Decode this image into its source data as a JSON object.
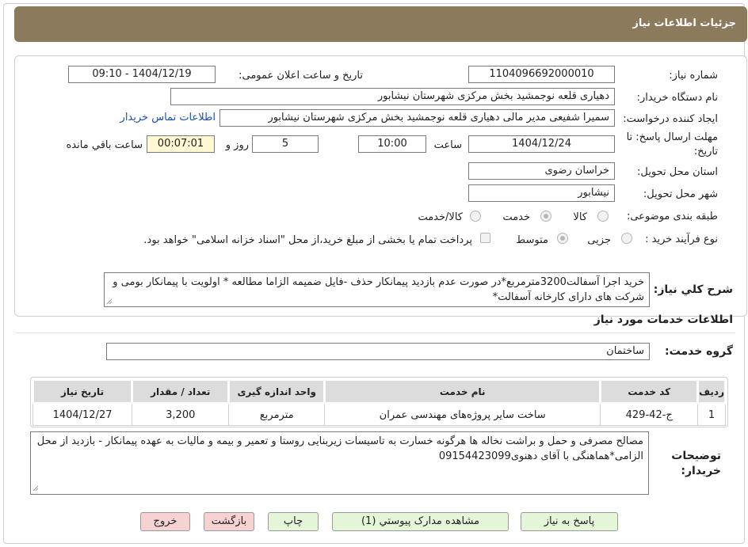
{
  "header": {
    "title": "جزئیات اطلاعات نیاز"
  },
  "form": {
    "need_number_label": "شماره نیاز:",
    "need_number": "1104096692000010",
    "announce_label": "تاریخ و ساعت اعلان عمومی:",
    "announce_value": "1404/12/19 - 09:10",
    "buyer_org_label": "نام دستگاه خریدار:",
    "buyer_org": "دهیاری قلعه نوجمشید بخش مرکزی شهرستان نیشابور",
    "requester_label": "ایجاد کننده درخواست:",
    "requester": "سمیرا شفیعی مدیر مالی دهیاری قلعه نوجمشید بخش مرکزی شهرستان نیشابور",
    "contact_link": "اطلاعات تماس خریدار",
    "deadline_label_1": "مهلت ارسال پاسخ: تا",
    "deadline_label_2": "تاریخ:",
    "deadline_date": "1404/12/24",
    "time_label": "ساعت",
    "deadline_time": "10:00",
    "days_value": "5",
    "days_label": "روز و",
    "remaining_value": "00:07:01",
    "remaining_label": "ساعت باقي مانده",
    "province_label": "استان محل تحویل:",
    "province": "خراسان رضوی",
    "city_label": "شهر محل تحویل:",
    "city": "نیشابور",
    "category_label": "طبقه بندی موضوعی:",
    "category_options": [
      "کالا",
      "خدمت",
      "کالا/خدمت"
    ],
    "category_selected": "خدمت",
    "process_label": "نوع فرآیند خرید :",
    "process_options": [
      "جزیی",
      "متوسط"
    ],
    "process_selected": "متوسط",
    "payment_note": "پرداخت تمام یا بخشی از مبلغ خرید،از محل \"اسناد خزانه اسلامی\" خواهد بود."
  },
  "description": {
    "label": "شرح کلي نیاز:",
    "text": "خرید اجرا آسفالت3200مترمربع*در صورت عدم بازدید پیمانکار حذف -فایل ضمیمه الزاما مطالعه * اولویت با پیمانکار بومی و شرکت های دارای کارخانه آسفالت*"
  },
  "services": {
    "section_title": "اطلاعات خدمات مورد نیاز",
    "group_label": "گروه خدمت:",
    "group_value": "ساختمان",
    "columns": [
      "ردیف",
      "کد خدمت",
      "نام خدمت",
      "واحد اندازه گیری",
      "تعداد / مقدار",
      "تاریخ نیاز"
    ],
    "rows": [
      [
        "1",
        "ج-42-429",
        "ساخت سایر پروژه‌های مهندسی عمران",
        "مترمربع",
        "3,200",
        "1404/12/27"
      ]
    ]
  },
  "buyer_notes": {
    "label_1": "توضیحات",
    "label_2": "خریدار:",
    "text": "مصالح مصرفی و حمل و براشت نخاله ها هرگونه خسارت به تاسیسات زیربنایی روستا و تعمیر و بیمه و مالیات به عهده پیمانکار - بازدید از محل الزامی*هماهنگی با آقای دهنوی09154423099"
  },
  "buttons": {
    "reply": "پاسخ به نیاز",
    "attachments": "مشاهده مدارک پیوستي (1)",
    "print": "چاپ",
    "back": "بازگشت",
    "exit": "خروج"
  },
  "colors": {
    "header_bg": "#8b7a5c",
    "link": "#1a4fb5",
    "green_button": "#e4f5d8",
    "pink_button": "#f7d2d2",
    "remaining_bg": "#fff8d2"
  }
}
